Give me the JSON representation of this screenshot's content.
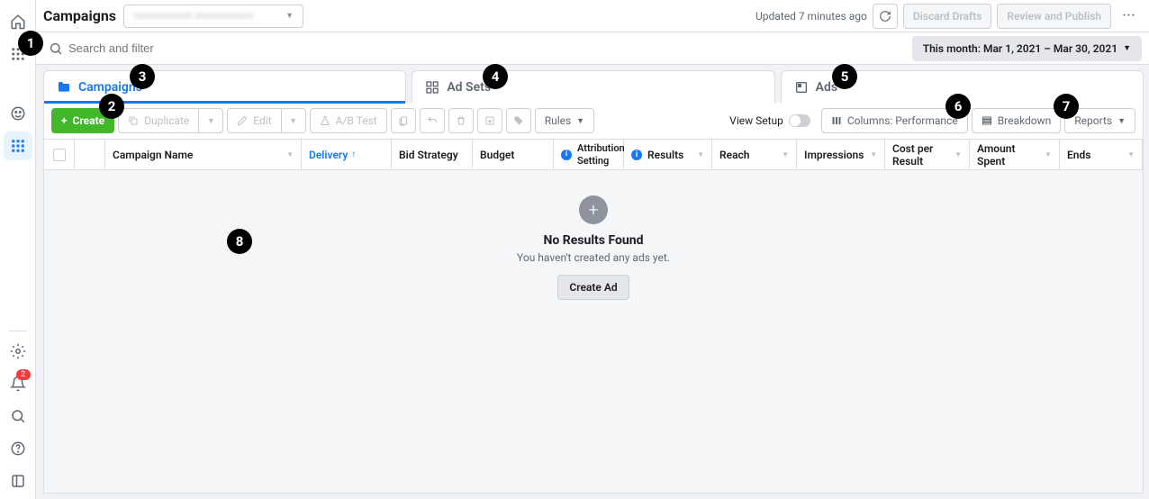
{
  "header": {
    "title": "Campaigns",
    "account": "———————  ———————",
    "updated": "Updated 7 minutes ago",
    "discard": "Discard Drafts",
    "review": "Review and Publish"
  },
  "search": {
    "placeholder": "Search and filter",
    "date_range": "This month: Mar 1, 2021 – Mar 30, 2021"
  },
  "tabs": {
    "campaigns": "Campaigns",
    "adsets": "Ad Sets",
    "ads": "Ads"
  },
  "toolbar": {
    "create": "Create",
    "duplicate": "Duplicate",
    "edit": "Edit",
    "abtest": "A/B Test",
    "rules": "Rules",
    "view_setup": "View Setup",
    "columns": "Columns: Performance",
    "breakdown": "Breakdown",
    "reports": "Reports"
  },
  "columns": {
    "name": "Campaign Name",
    "delivery": "Delivery",
    "bid": "Bid Strategy",
    "budget": "Budget",
    "attribution": "Attribution Setting",
    "results": "Results",
    "reach": "Reach",
    "impressions": "Impressions",
    "cost": "Cost per Result",
    "spent": "Amount Spent",
    "ends": "Ends"
  },
  "empty": {
    "title": "No Results Found",
    "sub": "You haven't created any ads yet.",
    "btn": "Create Ad"
  },
  "notifications_badge": "2",
  "callouts": [
    "1",
    "2",
    "3",
    "4",
    "5",
    "6",
    "7",
    "8"
  ]
}
